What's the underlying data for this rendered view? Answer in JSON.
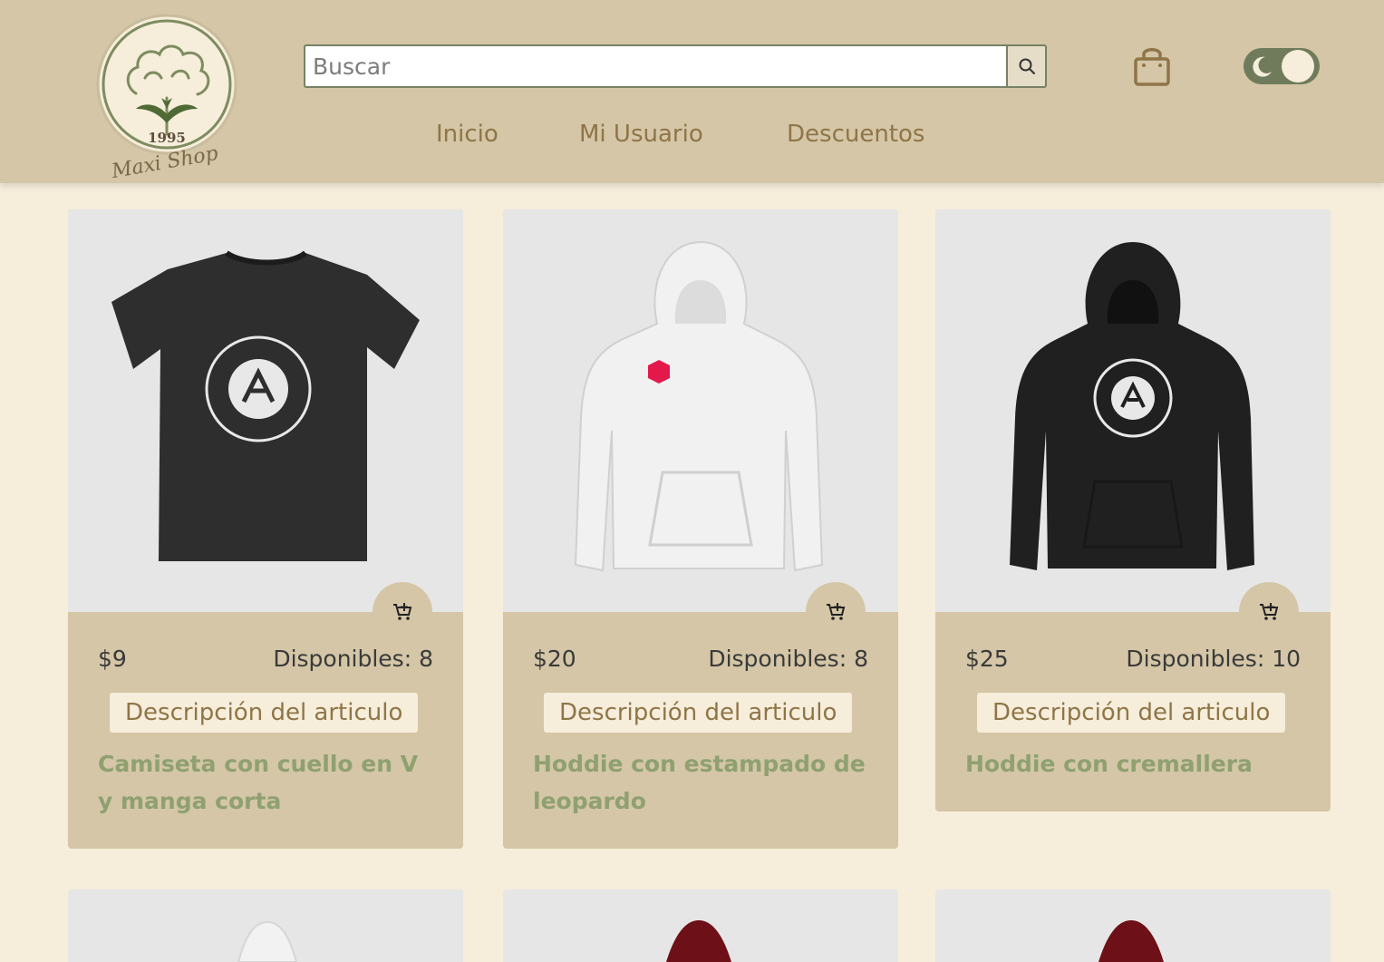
{
  "header": {
    "logo": {
      "year": "1995",
      "name": "Maxi Shop"
    },
    "search": {
      "placeholder": "Buscar",
      "value": ""
    },
    "nav": [
      {
        "label": "Inicio"
      },
      {
        "label": "Mi Usuario"
      },
      {
        "label": "Descuentos"
      }
    ],
    "icons": {
      "search": "search-icon",
      "cart": "shopping-bag-icon",
      "theme": "moon-icon"
    },
    "dark_mode": true
  },
  "products": [
    {
      "price": "$9",
      "stock": "Disponibles: 8",
      "description_label": "Descripción del articulo",
      "name": "Camiseta con cuello en V y manga corta",
      "garment": "black t-shirt"
    },
    {
      "price": "$20",
      "stock": "Disponibles: 8",
      "description_label": "Descripción del articulo",
      "name": "Hoddie con estampado de leopardo",
      "garment": "white hoodie"
    },
    {
      "price": "$25",
      "stock": "Disponibles: 10",
      "description_label": "Descripción del articulo",
      "name": "Hoddie con cremallera",
      "garment": "black hoodie"
    }
  ],
  "colors": {
    "header_bg": "#d4c6a6",
    "page_bg": "#f6eddb",
    "accent_brown": "#8f7547",
    "accent_green": "#8fa071",
    "toggle_green": "#6f7b5b"
  }
}
